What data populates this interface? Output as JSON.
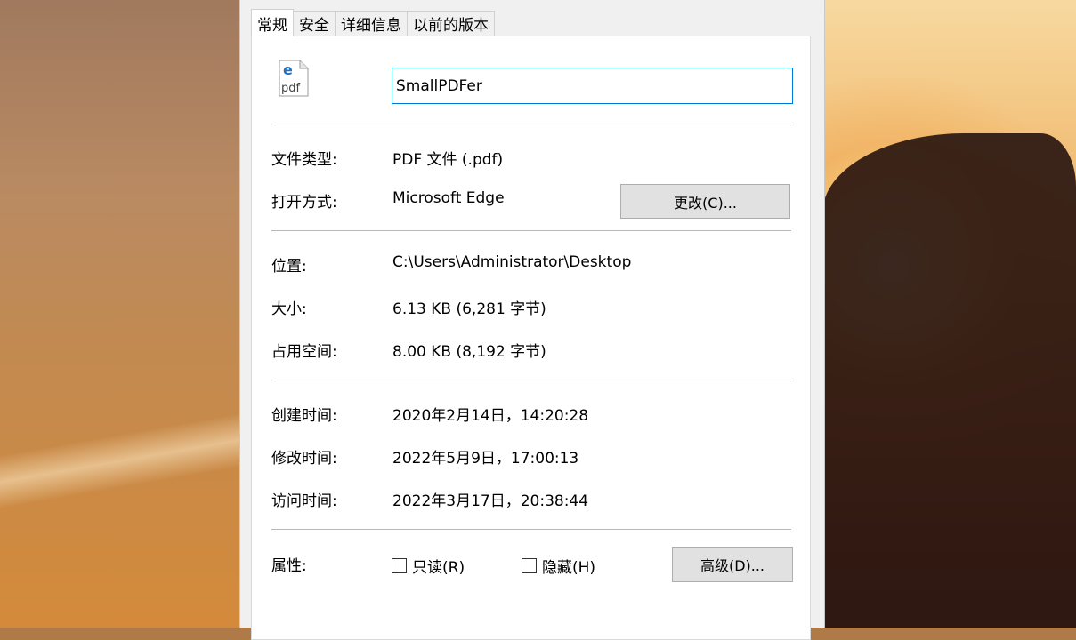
{
  "dialog": {
    "tabs": [
      {
        "label": "常规",
        "active": true
      },
      {
        "label": "安全",
        "active": false
      },
      {
        "label": "详细信息",
        "active": false
      },
      {
        "label": "以前的版本",
        "active": false
      }
    ],
    "file_icon_label": "pdf",
    "file_name": "SmallPDFer",
    "type_label": "文件类型:",
    "type_value": "PDF 文件 (.pdf)",
    "opens_with_label": "打开方式:",
    "opens_with_value": "Microsoft Edge",
    "change_button": "更改(C)...",
    "location_label": "位置:",
    "location_value": "C:\\Users\\Administrator\\Desktop",
    "size_label": "大小:",
    "size_value": "6.13 KB (6,281 字节)",
    "disk_size_label": "占用空间:",
    "disk_size_value": "8.00 KB (8,192 字节)",
    "created_label": "创建时间:",
    "created_value": "2020年2月14日，14:20:28",
    "modified_label": "修改时间:",
    "modified_value": "2022年5月9日，17:00:13",
    "accessed_label": "访问时间:",
    "accessed_value": "2022年3月17日，20:38:44",
    "attributes_label": "属性:",
    "readonly_label": "只读(R)",
    "readonly_checked": false,
    "hidden_label": "隐藏(H)",
    "hidden_checked": false,
    "advanced_button": "高级(D)..."
  },
  "colors": {
    "focus_border": "#0078d7",
    "edge_icon": "#1e73c8",
    "button_bg": "#e1e1e1"
  }
}
